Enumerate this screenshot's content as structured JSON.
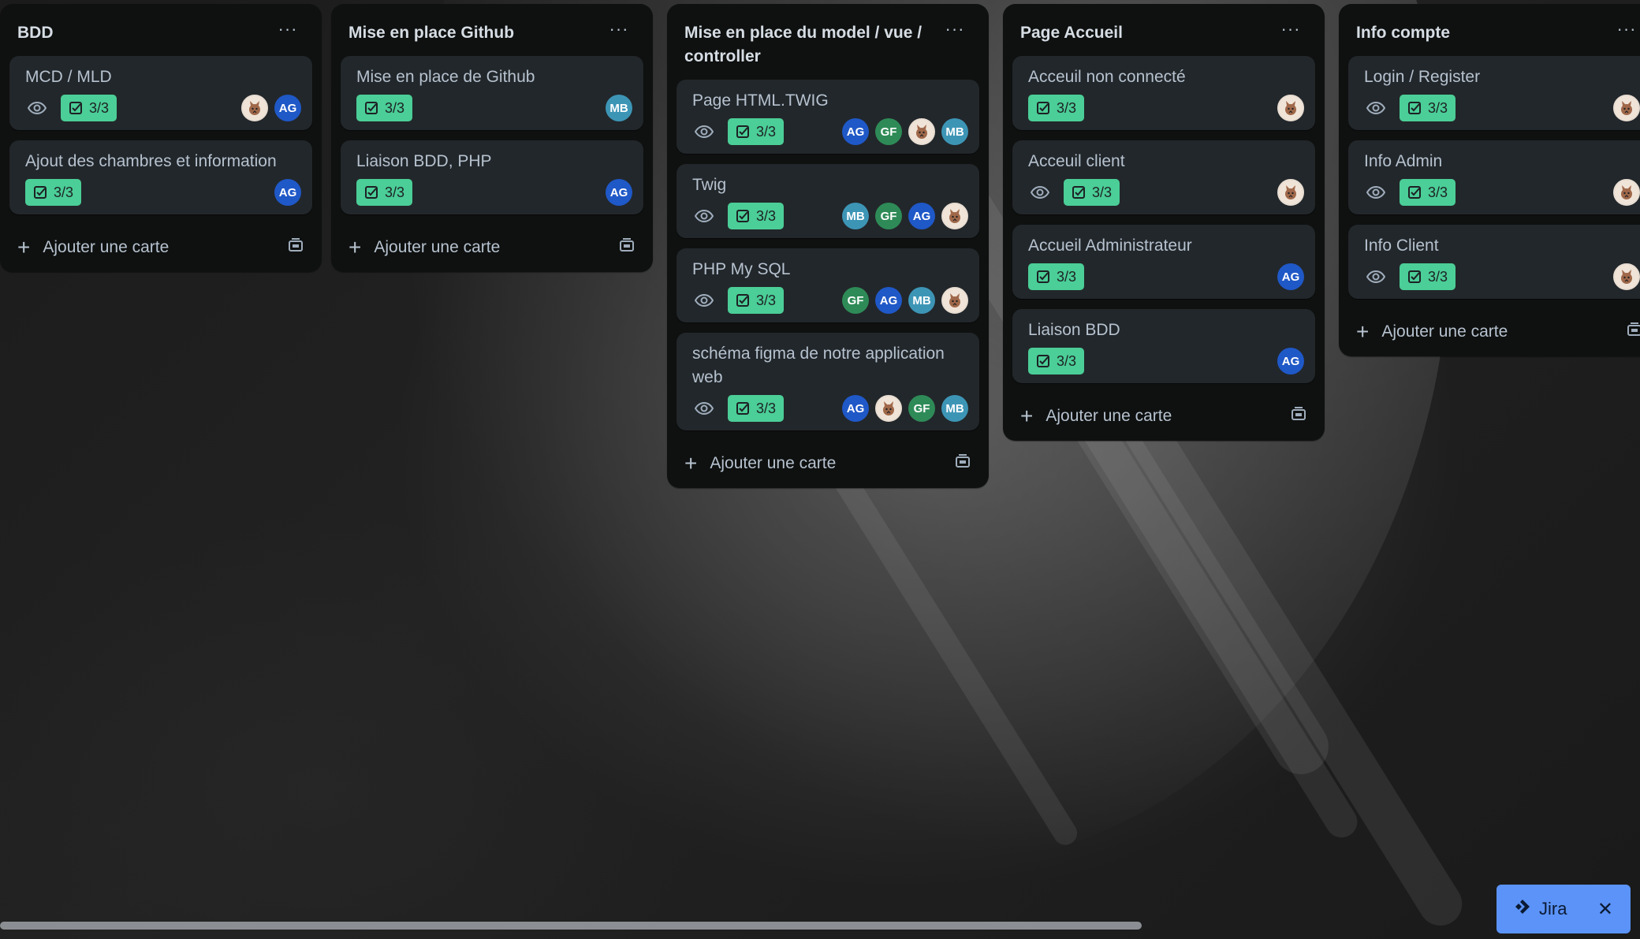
{
  "board": {
    "lists": [
      {
        "title": "BDD",
        "menu": "···",
        "add_label": "Ajouter une carte",
        "cards": [
          {
            "title": "MCD / MLD",
            "watch": true,
            "checklist": "3/3",
            "members": [
              "img",
              "AG"
            ]
          },
          {
            "title": "Ajout des chambres et information",
            "watch": false,
            "checklist": "3/3",
            "members": [
              "AG"
            ]
          }
        ]
      },
      {
        "title": "Mise en place Github",
        "menu": "···",
        "add_label": "Ajouter une carte",
        "cards": [
          {
            "title": "Mise en place de Github",
            "watch": false,
            "checklist": "3/3",
            "members": [
              "MB"
            ]
          },
          {
            "title": "Liaison BDD, PHP",
            "watch": false,
            "checklist": "3/3",
            "members": [
              "AG"
            ]
          }
        ]
      },
      {
        "title": "Mise en place du model / vue / controller",
        "menu": "···",
        "add_label": "Ajouter une carte",
        "cards": [
          {
            "title": "Page HTML.TWIG",
            "watch": true,
            "checklist": "3/3",
            "members": [
              "AG",
              "GF",
              "img",
              "MB"
            ]
          },
          {
            "title": "Twig",
            "watch": true,
            "checklist": "3/3",
            "members": [
              "MB",
              "GF",
              "AG",
              "img"
            ]
          },
          {
            "title": "PHP My SQL",
            "watch": true,
            "checklist": "3/3",
            "members": [
              "GF",
              "AG",
              "MB",
              "img"
            ]
          },
          {
            "title": "schéma figma de notre application web",
            "watch": true,
            "checklist": "3/3",
            "members": [
              "AG",
              "img",
              "GF",
              "MB"
            ]
          }
        ]
      },
      {
        "title": "Page Accueil",
        "menu": "···",
        "add_label": "Ajouter une carte",
        "cards": [
          {
            "title": "Acceuil non connecté",
            "watch": false,
            "checklist": "3/3",
            "members": [
              "img"
            ]
          },
          {
            "title": "Acceuil client",
            "watch": true,
            "checklist": "3/3",
            "members": [
              "img"
            ]
          },
          {
            "title": "Accueil Administrateur",
            "watch": false,
            "checklist": "3/3",
            "members": [
              "AG"
            ]
          },
          {
            "title": "Liaison BDD",
            "watch": false,
            "checklist": "3/3",
            "members": [
              "AG"
            ]
          }
        ]
      },
      {
        "title": "Info compte",
        "menu": "···",
        "add_label": "Ajouter une carte",
        "cards": [
          {
            "title": "Login / Register",
            "watch": true,
            "checklist": "3/3",
            "members": [
              "img"
            ]
          },
          {
            "title": "Info Admin",
            "watch": true,
            "checklist": "3/3",
            "members": [
              "img"
            ]
          },
          {
            "title": "Info Client",
            "watch": true,
            "checklist": "3/3",
            "members": [
              "img"
            ]
          }
        ]
      }
    ]
  },
  "jira": {
    "label": "Jira",
    "close": "✕"
  },
  "colors": {
    "badge": "#4bce97",
    "list_bg": "#0f1110",
    "card_bg": "#22272b",
    "AG": "#1f58c7",
    "GF": "#2e8b57",
    "MB": "#3d95b6",
    "jira": "#5b93f8"
  }
}
